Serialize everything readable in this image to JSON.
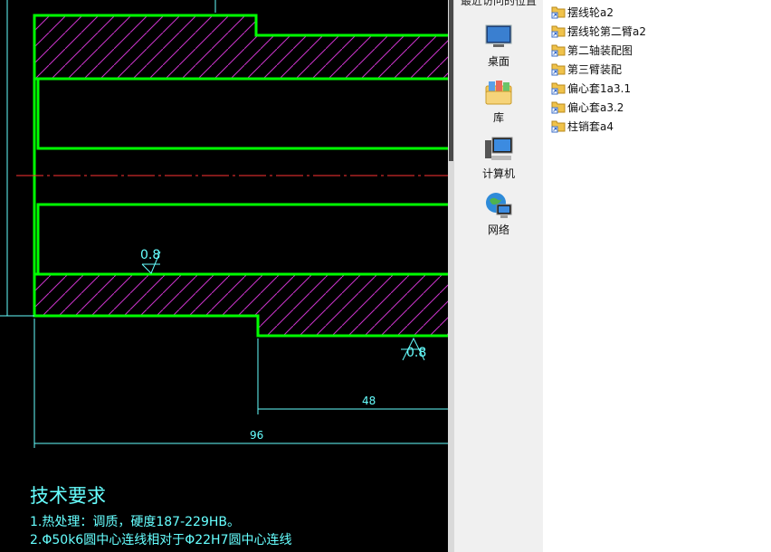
{
  "cad": {
    "roughness_top": "0.8",
    "roughness_bottom": "0.8",
    "dim_48": "48",
    "dim_96": "96",
    "tech_title": "技术要求",
    "tech_line1": "1.热处理：调质，硬度187-229HB。",
    "tech_line2": "2.Φ50k6圆中心连线相对于Φ22H7圆中心连线",
    "colors": {
      "outline": "#00ff00",
      "hatch": "#cc33cc",
      "dim": "#66ffff",
      "center": "#ff3333"
    }
  },
  "nav": {
    "header": "最近访问的位置",
    "items": [
      {
        "label": "桌面",
        "icon": "desktop-icon"
      },
      {
        "label": "库",
        "icon": "library-icon"
      },
      {
        "label": "计算机",
        "icon": "computer-icon"
      },
      {
        "label": "网络",
        "icon": "network-icon"
      }
    ]
  },
  "files": {
    "items": [
      {
        "name": "摆线轮a2",
        "icon": "folder-shortcut-icon"
      },
      {
        "name": "摆线轮第二臂a2",
        "icon": "folder-shortcut-icon"
      },
      {
        "name": "第二轴装配图",
        "icon": "folder-shortcut-icon"
      },
      {
        "name": "第三臂装配",
        "icon": "folder-shortcut-icon"
      },
      {
        "name": "偏心套1a3.1",
        "icon": "folder-shortcut-icon"
      },
      {
        "name": "偏心套a3.2",
        "icon": "folder-shortcut-icon"
      },
      {
        "name": "柱销套a4",
        "icon": "folder-shortcut-icon"
      }
    ]
  }
}
